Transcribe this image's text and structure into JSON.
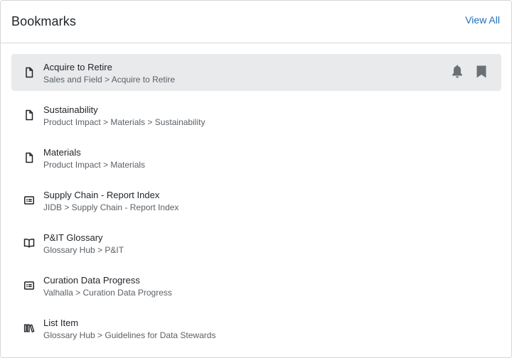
{
  "header": {
    "title": "Bookmarks",
    "view_all_label": "View All"
  },
  "colors": {
    "link": "#1f6fb9",
    "active_row_bg": "#e9eaeb",
    "icon_muted": "#6b7075"
  },
  "bookmarks": [
    {
      "name": "Acquire to Retire",
      "path": "Sales and Field > Acquire to Retire",
      "icon": "document-icon",
      "active": true
    },
    {
      "name": "Sustainability",
      "path": "Product Impact > Materials > Sustainability",
      "icon": "document-icon"
    },
    {
      "name": "Materials",
      "path": "Product Impact > Materials",
      "icon": "document-icon"
    },
    {
      "name": "Supply Chain - Report Index",
      "path": "JIDB > Supply Chain - Report Index",
      "icon": "report-icon"
    },
    {
      "name": "P&IT Glossary",
      "path": "Glossary Hub > P&IT",
      "icon": "book-open-icon"
    },
    {
      "name": "Curation Data Progress",
      "path": "Valhalla > Curation Data Progress",
      "icon": "report-icon"
    },
    {
      "name": "List Item",
      "path": "Glossary Hub > Guidelines for Data Stewards",
      "icon": "library-icon"
    }
  ],
  "row_actions": {
    "notify_icon": "bell-icon",
    "bookmark_icon": "bookmark-icon"
  }
}
